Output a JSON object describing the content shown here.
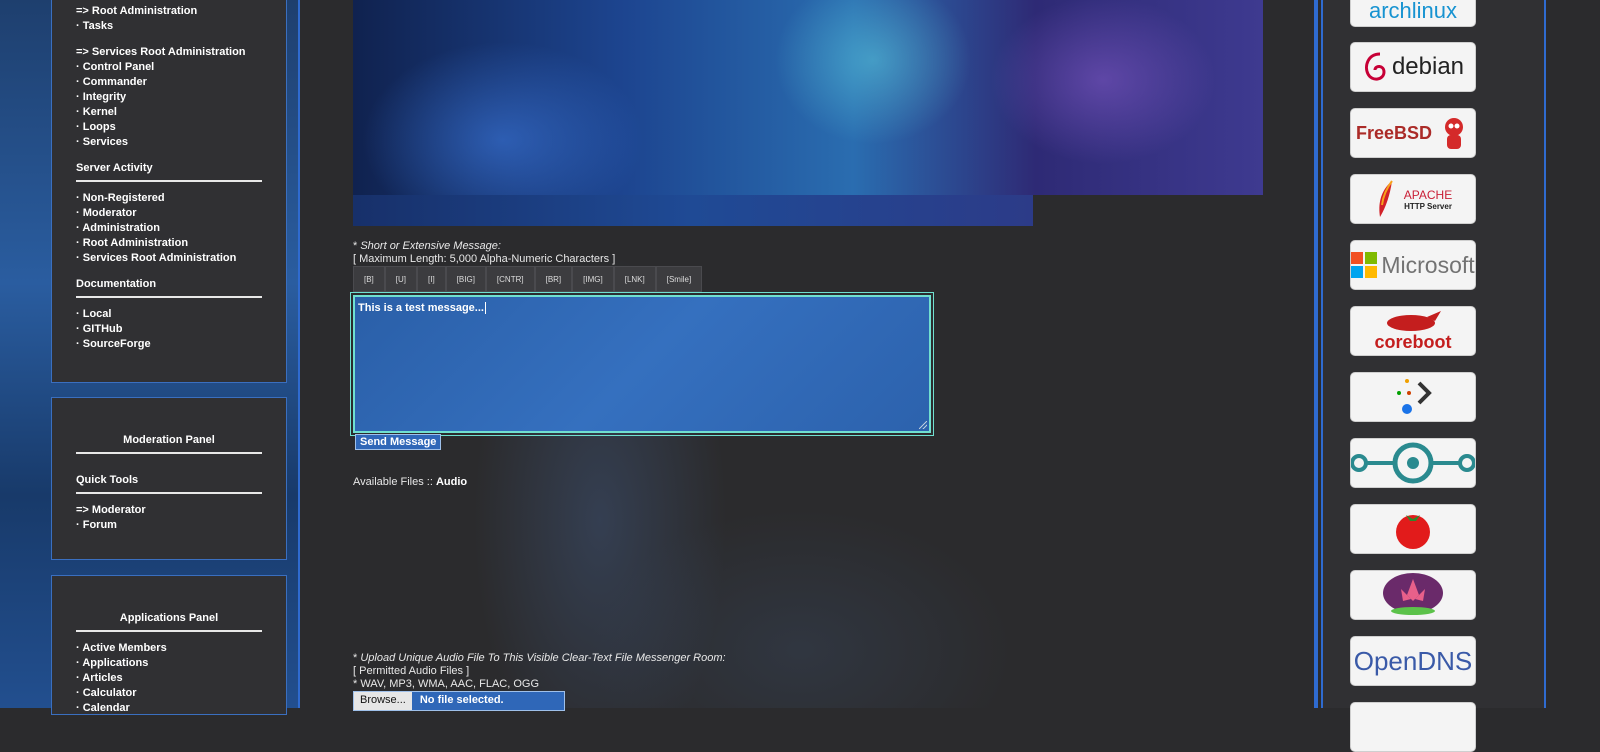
{
  "sidebar": {
    "root_admin": "=> Root Administration",
    "tasks": "Tasks",
    "services_root_admin": "=> Services Root Administration",
    "services_items": [
      "Control Panel",
      "Commander",
      "Integrity",
      "Kernel",
      "Loops",
      "Services"
    ],
    "server_activity": {
      "heading": "Server Activity",
      "items": [
        "Non-Registered",
        "Moderator",
        "Administration",
        "Root Administration",
        "Services Root Administration"
      ]
    },
    "documentation": {
      "heading": "Documentation",
      "items": [
        "Local",
        "GITHub",
        "SourceForge"
      ]
    },
    "moderation_panel": {
      "title": "Moderation Panel",
      "quick_tools": "Quick Tools",
      "moderator": "=> Moderator",
      "forum": "Forum"
    },
    "applications_panel": {
      "title": "Applications Panel",
      "items": [
        "Active Members",
        "Applications",
        "Articles",
        "Calculator",
        "Calendar"
      ]
    }
  },
  "main": {
    "message_label": "Short or Extensive Message:",
    "star": "*",
    "max_length": "[ Maximum Length: 5,000 Alpha-Numeric Characters ]",
    "toolbar": [
      "[B]",
      "[U]",
      "[I]",
      "[BIG]",
      "[CNTR]",
      "[BR]",
      "[IMG]",
      "[LNK]",
      "[Smile]"
    ],
    "message_value": "This is a test message...",
    "send_label": "Send Message",
    "available_files_prefix": "Available Files :: ",
    "available_files_type": "Audio",
    "upload_label": "Upload Unique Audio File To This Visible Clear-Text File Messenger Room",
    "permitted": "[ Permitted Audio Files ]",
    "formats": "* WAV, MP3, WMA, AAC, FLAC, OGG",
    "browse_label": "Browse...",
    "no_file": "No file selected."
  },
  "logos": {
    "archlinux": "archlinux",
    "debian": "debian",
    "freebsd": "FreeBSD",
    "apache_top": "APACHE",
    "apache_bottom": "HTTP Server",
    "microsoft": "Microsoft",
    "coreboot": "coreboot",
    "opendns": "OpenDNS"
  },
  "colors": {
    "accent": "#2f6bd0",
    "textarea": "#2f67b8",
    "focus": "#70e0d0"
  }
}
